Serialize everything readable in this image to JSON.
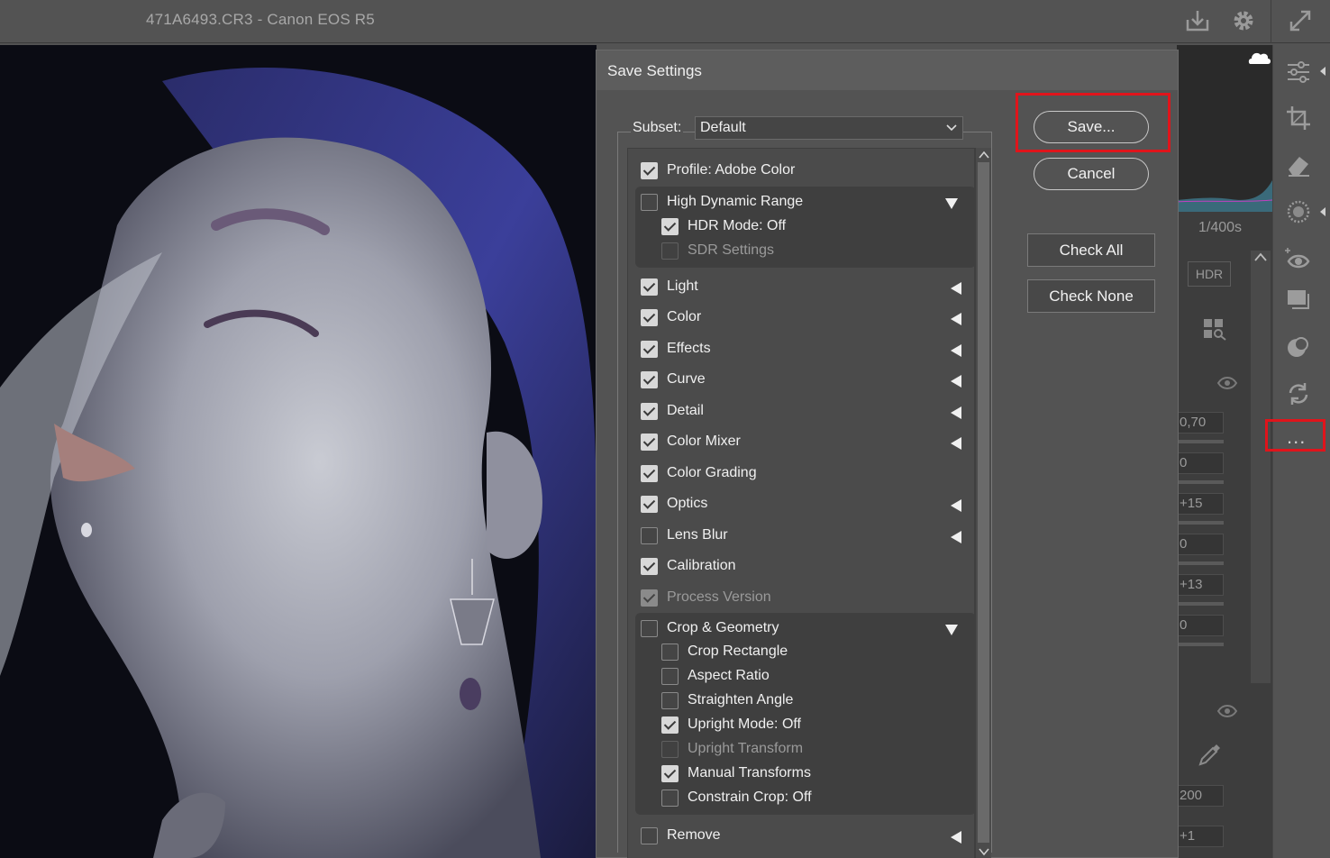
{
  "window": {
    "title": "471A6493.CR3  -  Canon EOS R5"
  },
  "icons": {
    "download": "download-icon",
    "settings": "gear-icon",
    "fullscreen": "expand-icon"
  },
  "background_panel": {
    "shutter": "1/400s",
    "hdr_button": "HDR",
    "values": [
      "0,70",
      "0",
      "+15",
      "0",
      "+13",
      "0",
      "200",
      "+1"
    ]
  },
  "dialog": {
    "title": "Save Settings",
    "subset_label": "Subset:",
    "subset_value": "Default",
    "buttons": {
      "save": "Save...",
      "cancel": "Cancel",
      "check_all": "Check All",
      "check_none": "Check None"
    },
    "items": [
      {
        "label": "Profile: Adobe Color",
        "state": "checked",
        "indent": 0
      },
      {
        "label": "High Dynamic Range",
        "state": "unchecked",
        "indent": 0,
        "arrow": "down",
        "group": true
      },
      {
        "label": "HDR Mode: Off",
        "state": "checked",
        "indent": 1
      },
      {
        "label": "SDR Settings",
        "state": "disabled",
        "indent": 1
      },
      {
        "label": "Light",
        "state": "checked",
        "indent": 0,
        "arrow": "left"
      },
      {
        "label": "Color",
        "state": "checked",
        "indent": 0,
        "arrow": "left"
      },
      {
        "label": "Effects",
        "state": "checked",
        "indent": 0,
        "arrow": "left"
      },
      {
        "label": "Curve",
        "state": "checked",
        "indent": 0,
        "arrow": "left"
      },
      {
        "label": "Detail",
        "state": "checked",
        "indent": 0,
        "arrow": "left"
      },
      {
        "label": "Color Mixer",
        "state": "checked",
        "indent": 0,
        "arrow": "left"
      },
      {
        "label": "Color Grading",
        "state": "checked",
        "indent": 0
      },
      {
        "label": "Optics",
        "state": "checked",
        "indent": 0,
        "arrow": "left"
      },
      {
        "label": "Lens Blur",
        "state": "unchecked",
        "indent": 0,
        "arrow": "left"
      },
      {
        "label": "Calibration",
        "state": "checked",
        "indent": 0
      },
      {
        "label": "Process Version",
        "state": "checked-disabled",
        "indent": 0
      },
      {
        "label": "Crop & Geometry",
        "state": "unchecked",
        "indent": 0,
        "arrow": "down",
        "group": true
      },
      {
        "label": "Crop Rectangle",
        "state": "unchecked",
        "indent": 1
      },
      {
        "label": "Aspect Ratio",
        "state": "unchecked",
        "indent": 1
      },
      {
        "label": "Straighten Angle",
        "state": "unchecked",
        "indent": 1
      },
      {
        "label": "Upright Mode: Off",
        "state": "checked",
        "indent": 1
      },
      {
        "label": "Upright Transform",
        "state": "disabled",
        "indent": 1
      },
      {
        "label": "Manual Transforms",
        "state": "checked",
        "indent": 1
      },
      {
        "label": "Constrain Crop: Off",
        "state": "unchecked",
        "indent": 1
      },
      {
        "label": "Remove",
        "state": "unchecked",
        "indent": 0,
        "arrow": "left"
      }
    ]
  },
  "toolbar": {
    "tools": [
      "sliders-icon",
      "crop-icon",
      "eraser-icon",
      "mask-icon",
      "redeye-icon",
      "presets-icon",
      "snapshots-icon",
      "sync-icon"
    ],
    "more": "..."
  },
  "colors": {
    "highlight": "#e0141b",
    "dialog_bg": "#535353",
    "list_bg": "#4b4b4b"
  }
}
